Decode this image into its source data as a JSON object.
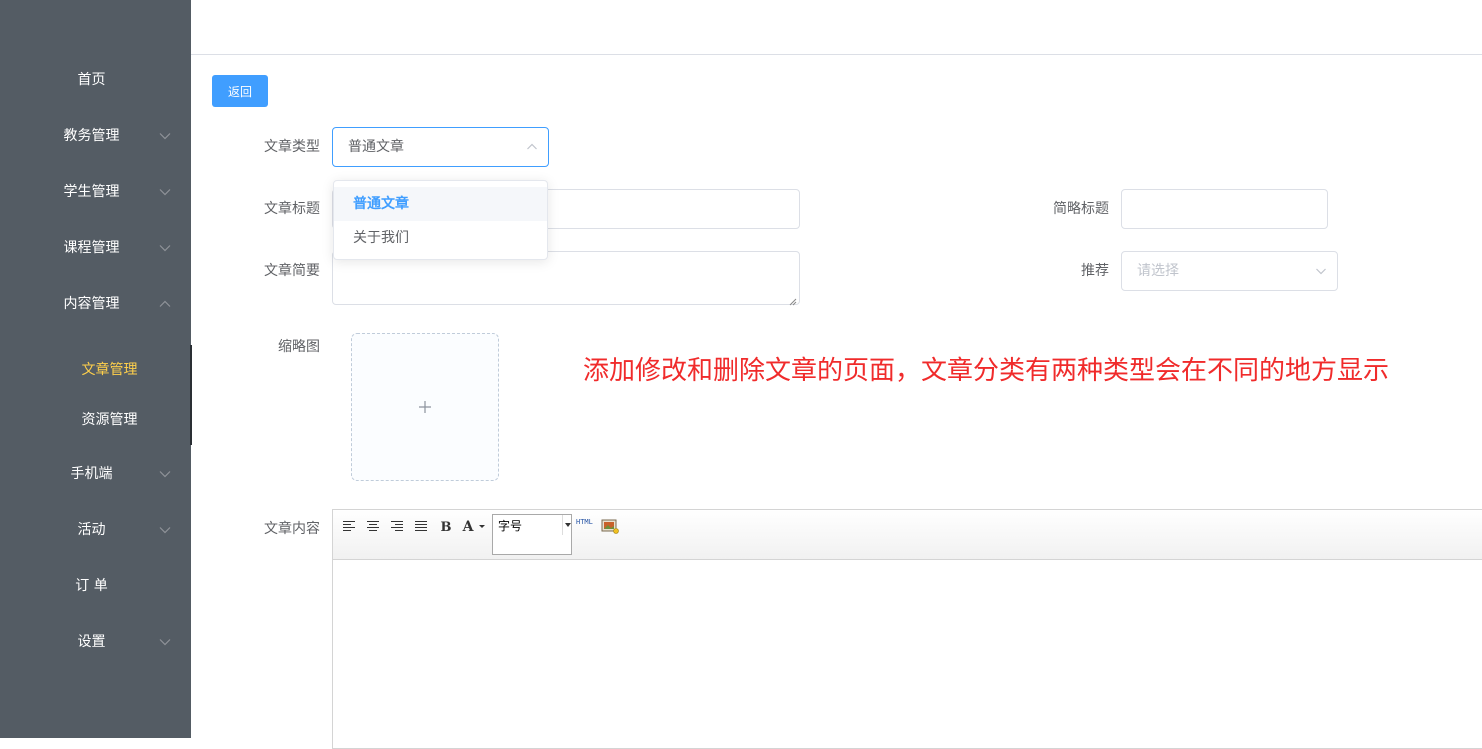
{
  "sidebar": {
    "items": [
      {
        "label": "首页",
        "has_submenu": false
      },
      {
        "label": "教务管理",
        "has_submenu": true
      },
      {
        "label": "学生管理",
        "has_submenu": true
      },
      {
        "label": "课程管理",
        "has_submenu": true
      },
      {
        "label": "内容管理",
        "has_submenu": true,
        "expanded": true
      },
      {
        "label": "手机端",
        "has_submenu": true
      },
      {
        "label": "活动",
        "has_submenu": true
      },
      {
        "label": "订 单",
        "has_submenu": false
      },
      {
        "label": "设置",
        "has_submenu": true
      }
    ],
    "sub_items": [
      {
        "label": "文章管理",
        "active": true
      },
      {
        "label": "资源管理",
        "active": false
      }
    ],
    "bg_color": "#545c64",
    "active_color": "#ffd04b"
  },
  "toolbar": {
    "back_label": "返回"
  },
  "form": {
    "type_label": "文章类型",
    "type_value": "普通文章",
    "type_options": [
      "普通文章",
      "关于我们"
    ],
    "title_label": "文章标题",
    "title_value": "",
    "short_title_label": "简略标题",
    "short_title_value": "",
    "summary_label": "文章简要",
    "summary_value": "",
    "recommend_label": "推荐",
    "recommend_placeholder": "请选择",
    "thumbnail_label": "缩略图",
    "content_label": "文章内容"
  },
  "editor": {
    "font_size_label": "字号",
    "html_label": "HTML",
    "buttons": [
      "align-left-icon",
      "align-center-icon",
      "align-right-icon",
      "align-justify-icon",
      "bold-icon",
      "font-color-icon",
      "font-size-select",
      "html-icon",
      "image-icon"
    ]
  },
  "annotation": "添加修改和删除文章的页面，文章分类有两种类型会在不同的地方显示",
  "colors": {
    "primary": "#409eff",
    "annotation": "#f02b2b",
    "border": "#dcdfe6"
  }
}
